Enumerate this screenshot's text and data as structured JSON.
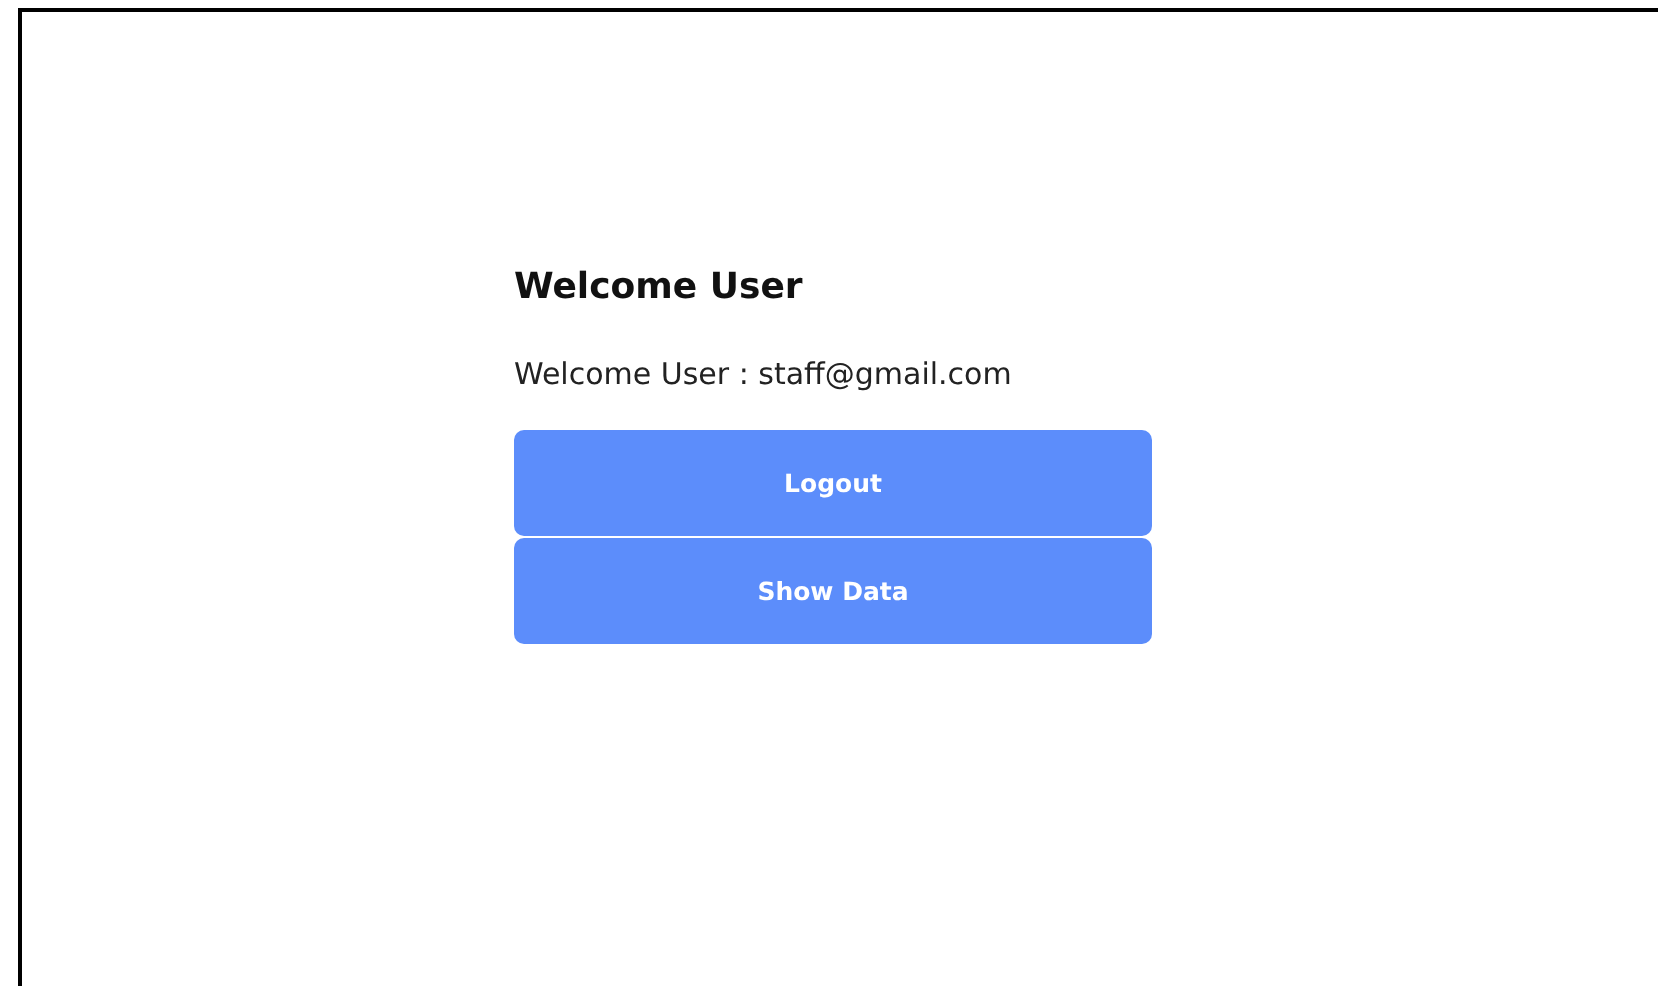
{
  "heading": "Welcome User",
  "greeting": "Welcome User : staff@gmail.com",
  "buttons": [
    {
      "label": "Logout"
    },
    {
      "label": "Show Data"
    }
  ]
}
